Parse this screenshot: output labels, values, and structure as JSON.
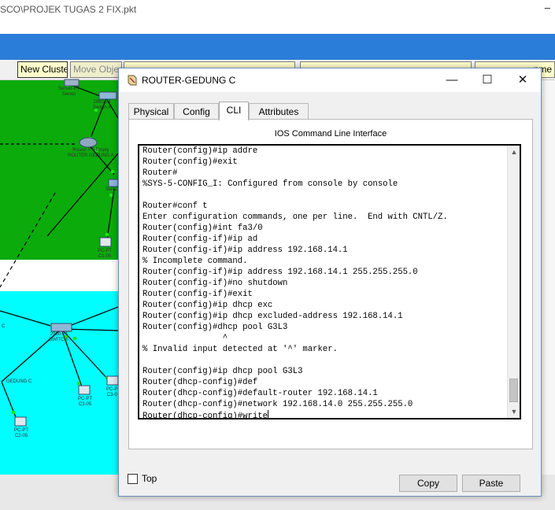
{
  "background_app": {
    "title": "SCO\\PROJEK TUGAS 2 FIX.pkt",
    "title_cut_glyph": "–",
    "toolbar": {
      "new_cluster": "New Cluster",
      "move_object": "Move Objec",
      "cut_right": "nme"
    },
    "node_labels": [
      "Server-PT\nServer",
      "2960-24\nSwitch A",
      "Router-PT-Empty\nROUTER GEDUNG A",
      "Switc",
      "PC-PT\nC1-05",
      "2960-24\nSWITCH-",
      "C",
      "GEDUNG C",
      "PC-PT\nC3-05",
      "PC-P\nC3-0",
      "PC-PT\nC2-05"
    ]
  },
  "dialog": {
    "title": "ROUTER-GEDUNG C",
    "controls": {
      "minimize": "—",
      "maximize": "☐",
      "close": "✕"
    },
    "tabs": [
      {
        "label": "Physical",
        "active": false
      },
      {
        "label": "Config",
        "active": false
      },
      {
        "label": "CLI",
        "active": true
      },
      {
        "label": "Attributes",
        "active": false
      }
    ],
    "cli": {
      "header": "IOS Command Line Interface",
      "lines": [
        "Router(config)#ip addre",
        "Router(config)#exit",
        "Router#",
        "%SYS-5-CONFIG_I: Configured from console by console",
        "",
        "Router#conf t",
        "Enter configuration commands, one per line.  End with CNTL/Z.",
        "Router(config)#int fa3/0",
        "Router(config-if)#ip ad",
        "Router(config-if)#ip address 192.168.14.1",
        "% Incomplete command.",
        "Router(config-if)#ip address 192.168.14.1 255.255.255.0",
        "Router(config-if)#no shutdown",
        "Router(config-if)#exit",
        "Router(config)#ip dhcp exc",
        "Router(config)#ip dhcp excluded-address 192.168.14.1",
        "Router(config)#dhcp pool G3L3",
        "                ^",
        "% Invalid input detected at '^' marker.",
        "",
        "Router(config)#ip dhcp pool G3L3",
        "Router(dhcp-config)#def",
        "Router(dhcp-config)#default-router 192.168.14.1",
        "Router(dhcp-config)#network 192.168.14.0 255.255.255.0",
        "Router(dhcp-config)#write"
      ],
      "scroll_up": "▲",
      "scroll_down": "▼"
    },
    "buttons": {
      "copy": "Copy",
      "paste": "Paste"
    },
    "top_checkbox": {
      "label": "Top",
      "checked": false
    }
  },
  "colors": {
    "band_blue": "#2a7dd8",
    "canvas_green": "#0aab0a",
    "canvas_cyan": "#00fefe"
  }
}
